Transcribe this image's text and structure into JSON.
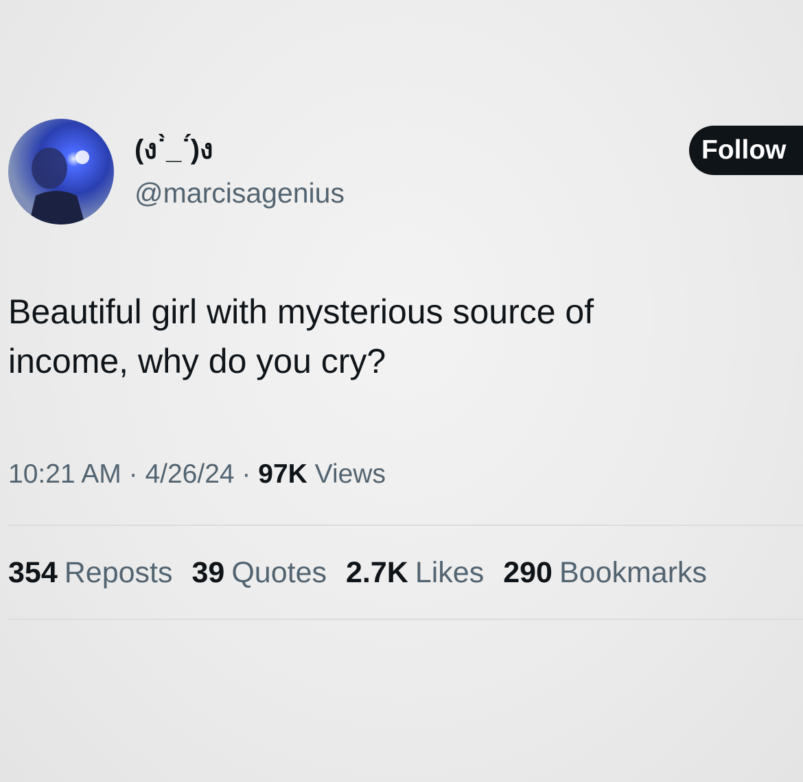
{
  "user": {
    "display_name": "(ง˙̀_˙́)ง",
    "handle": "@marcisagenius"
  },
  "follow_label": "Follow",
  "tweet": {
    "line1": "Beautiful girl with mysterious source of",
    "line2": "income, why do you cry?"
  },
  "meta": {
    "time": "10:21 AM",
    "sep1": " · ",
    "date": "4/26/24",
    "sep2": " · ",
    "views_count": "97K",
    "views_label": "Views"
  },
  "stats": [
    {
      "count": "354",
      "label": "Reposts"
    },
    {
      "count": "39",
      "label": "Quotes"
    },
    {
      "count": "2.7K",
      "label": "Likes"
    },
    {
      "count": "290",
      "label": "Bookmarks"
    }
  ],
  "colors": {
    "text_primary": "#0f1419",
    "text_secondary": "#536471",
    "button_bg": "#0f1419",
    "button_text": "#ffffff",
    "background": "#ebebeb"
  }
}
